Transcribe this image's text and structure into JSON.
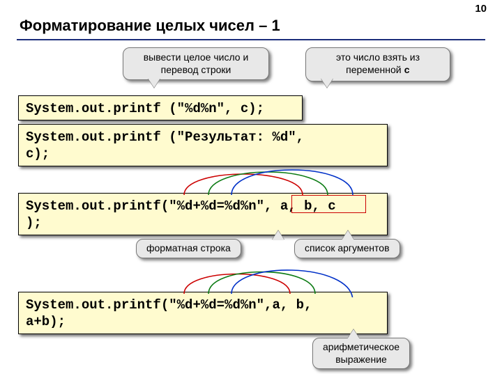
{
  "page_number": "10",
  "title": "Форматирование целых чисел – 1",
  "callouts": {
    "c1": "вывести целое число и\nперевод строки",
    "c2_a": "это число взять из",
    "c2_b": "переменной ",
    "c2_c": "c",
    "c3": "форматная строка",
    "c4": "список аргументов",
    "c5": "арифметическое\nвыражение"
  },
  "code": {
    "line1": "System.out.printf (\"%d%n\", c);",
    "line2": "System.out.printf (\"Результат: %d\",\nc);",
    "line3": "System.out.printf(\"%d+%d=%d%n\", a, b, c\n);",
    "line4": "System.out.printf(\"%d+%d=%d%n\",a, b,\na+b);"
  }
}
